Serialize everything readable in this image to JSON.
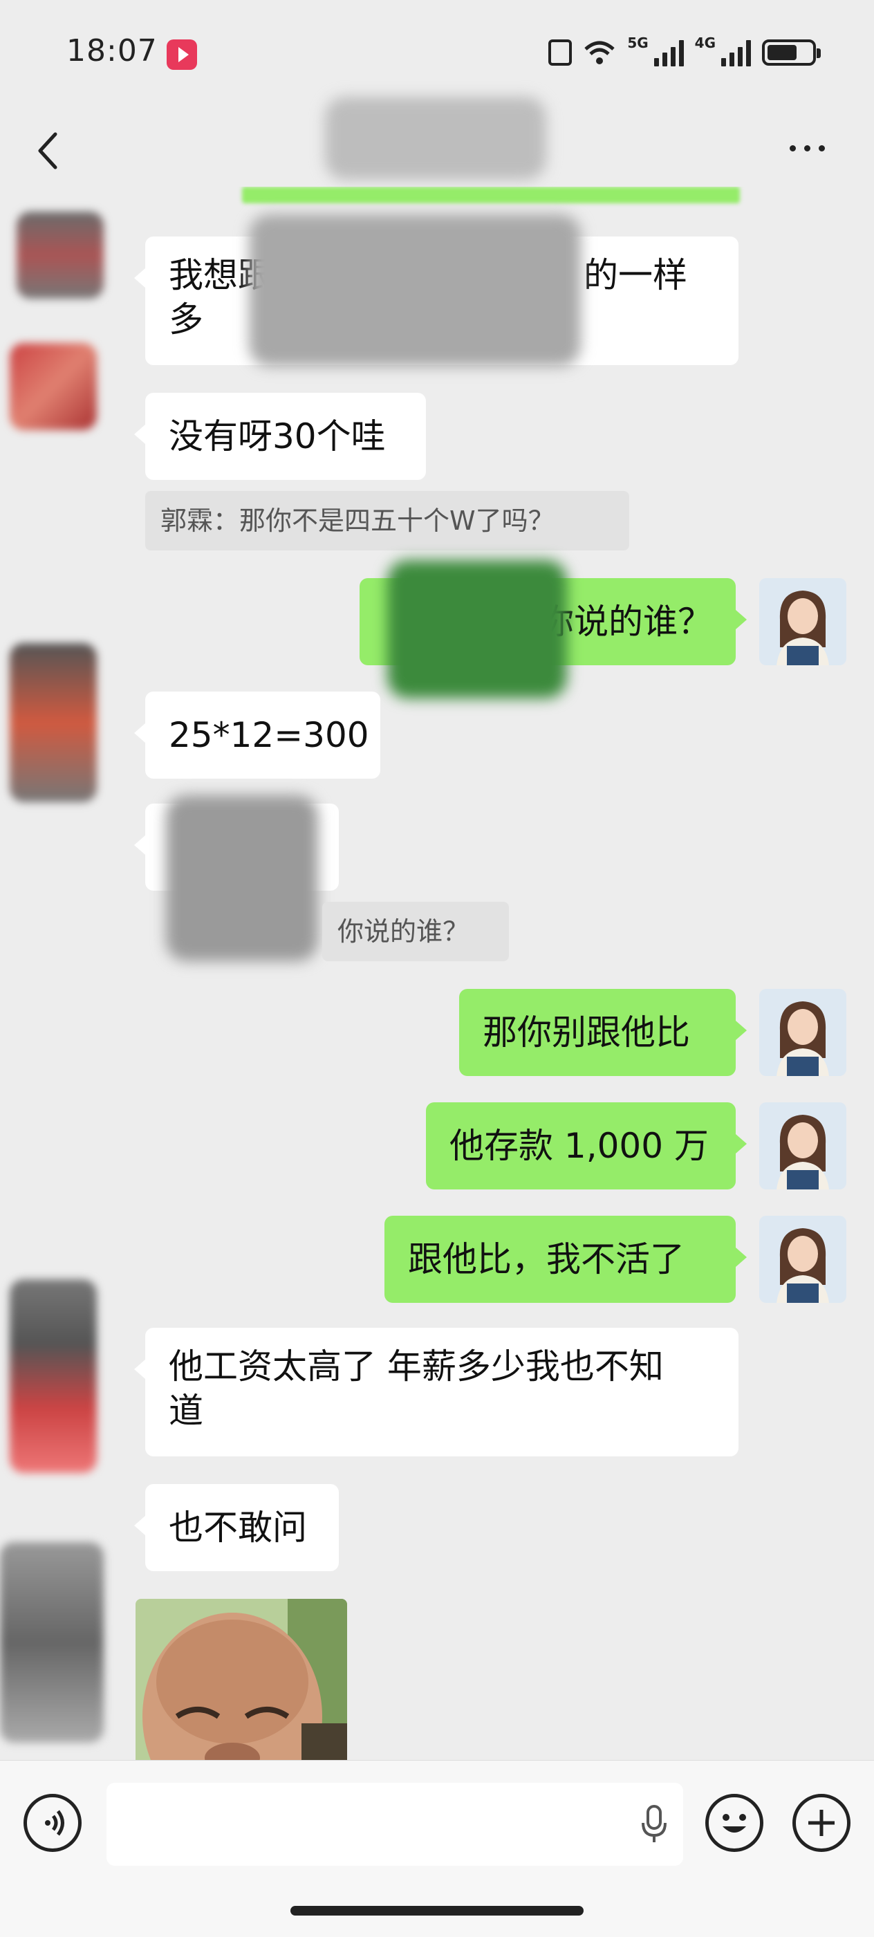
{
  "status_bar": {
    "time": "18:07",
    "network_1": "5G",
    "network_2": "4G",
    "wifi_badge": "7"
  },
  "messages": [
    {
      "dir": "in",
      "text_line1": "我想跟",
      "text_line1_tail": "的一样",
      "text_line2": "多",
      "redacted": true
    },
    {
      "dir": "in",
      "text": "没有呀30个哇"
    },
    {
      "dir": "quote",
      "text": "郭霖：那你不是四五十个W了吗？"
    },
    {
      "dir": "out",
      "text": "你说的谁？",
      "redacted": true
    },
    {
      "dir": "in",
      "text": "25*12=300"
    },
    {
      "dir": "quote",
      "text": "你说的谁？"
    },
    {
      "dir": "out",
      "text": "那你别跟他比"
    },
    {
      "dir": "out",
      "text": "他存款 1,000 万"
    },
    {
      "dir": "out",
      "text": "跟他比，我不活了"
    },
    {
      "dir": "in",
      "text_line1": "他工资太高了 年薪多少我也不知",
      "text_line2": "道"
    },
    {
      "dir": "in",
      "text": "也不敢问"
    },
    {
      "dir": "in",
      "type": "sticker"
    }
  ],
  "icons": {
    "back": "back-chevron-icon",
    "more": "more-dots-icon",
    "voice": "voice-input-icon",
    "mic": "microphone-icon",
    "emoji": "emoji-icon",
    "plus": "plus-icon"
  },
  "colors": {
    "background": "#ededed",
    "bubble_out": "#95ec69",
    "bubble_in": "#ffffff"
  }
}
